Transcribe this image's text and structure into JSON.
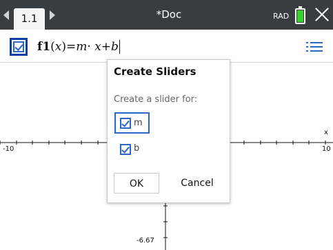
{
  "tab": {
    "label": "1.1"
  },
  "document": {
    "title": "*Doc"
  },
  "status": {
    "angle_mode": "RAD"
  },
  "entry": {
    "fn": "f1",
    "arg": "x",
    "body": "=m· x+b"
  },
  "graph": {
    "x_min_label": "-10",
    "x_max_label": "10",
    "x_axis_name": "x",
    "y_min_label": "-6.67"
  },
  "dialog": {
    "title": "Create Sliders",
    "subtitle": "Create a slider for:",
    "options": [
      {
        "label": "m",
        "checked": true
      },
      {
        "label": "b",
        "checked": true
      }
    ],
    "ok_label": "OK",
    "cancel_label": "Cancel"
  },
  "colors": {
    "topbar": "#3a3d40",
    "accent": "#2b66cb",
    "battery": "#39d12b"
  },
  "icons": {
    "nav_left": "triangle-left-icon",
    "nav_right": "triangle-right-icon",
    "battery": "battery-icon",
    "close": "close-icon",
    "menu": "menu-icon"
  }
}
